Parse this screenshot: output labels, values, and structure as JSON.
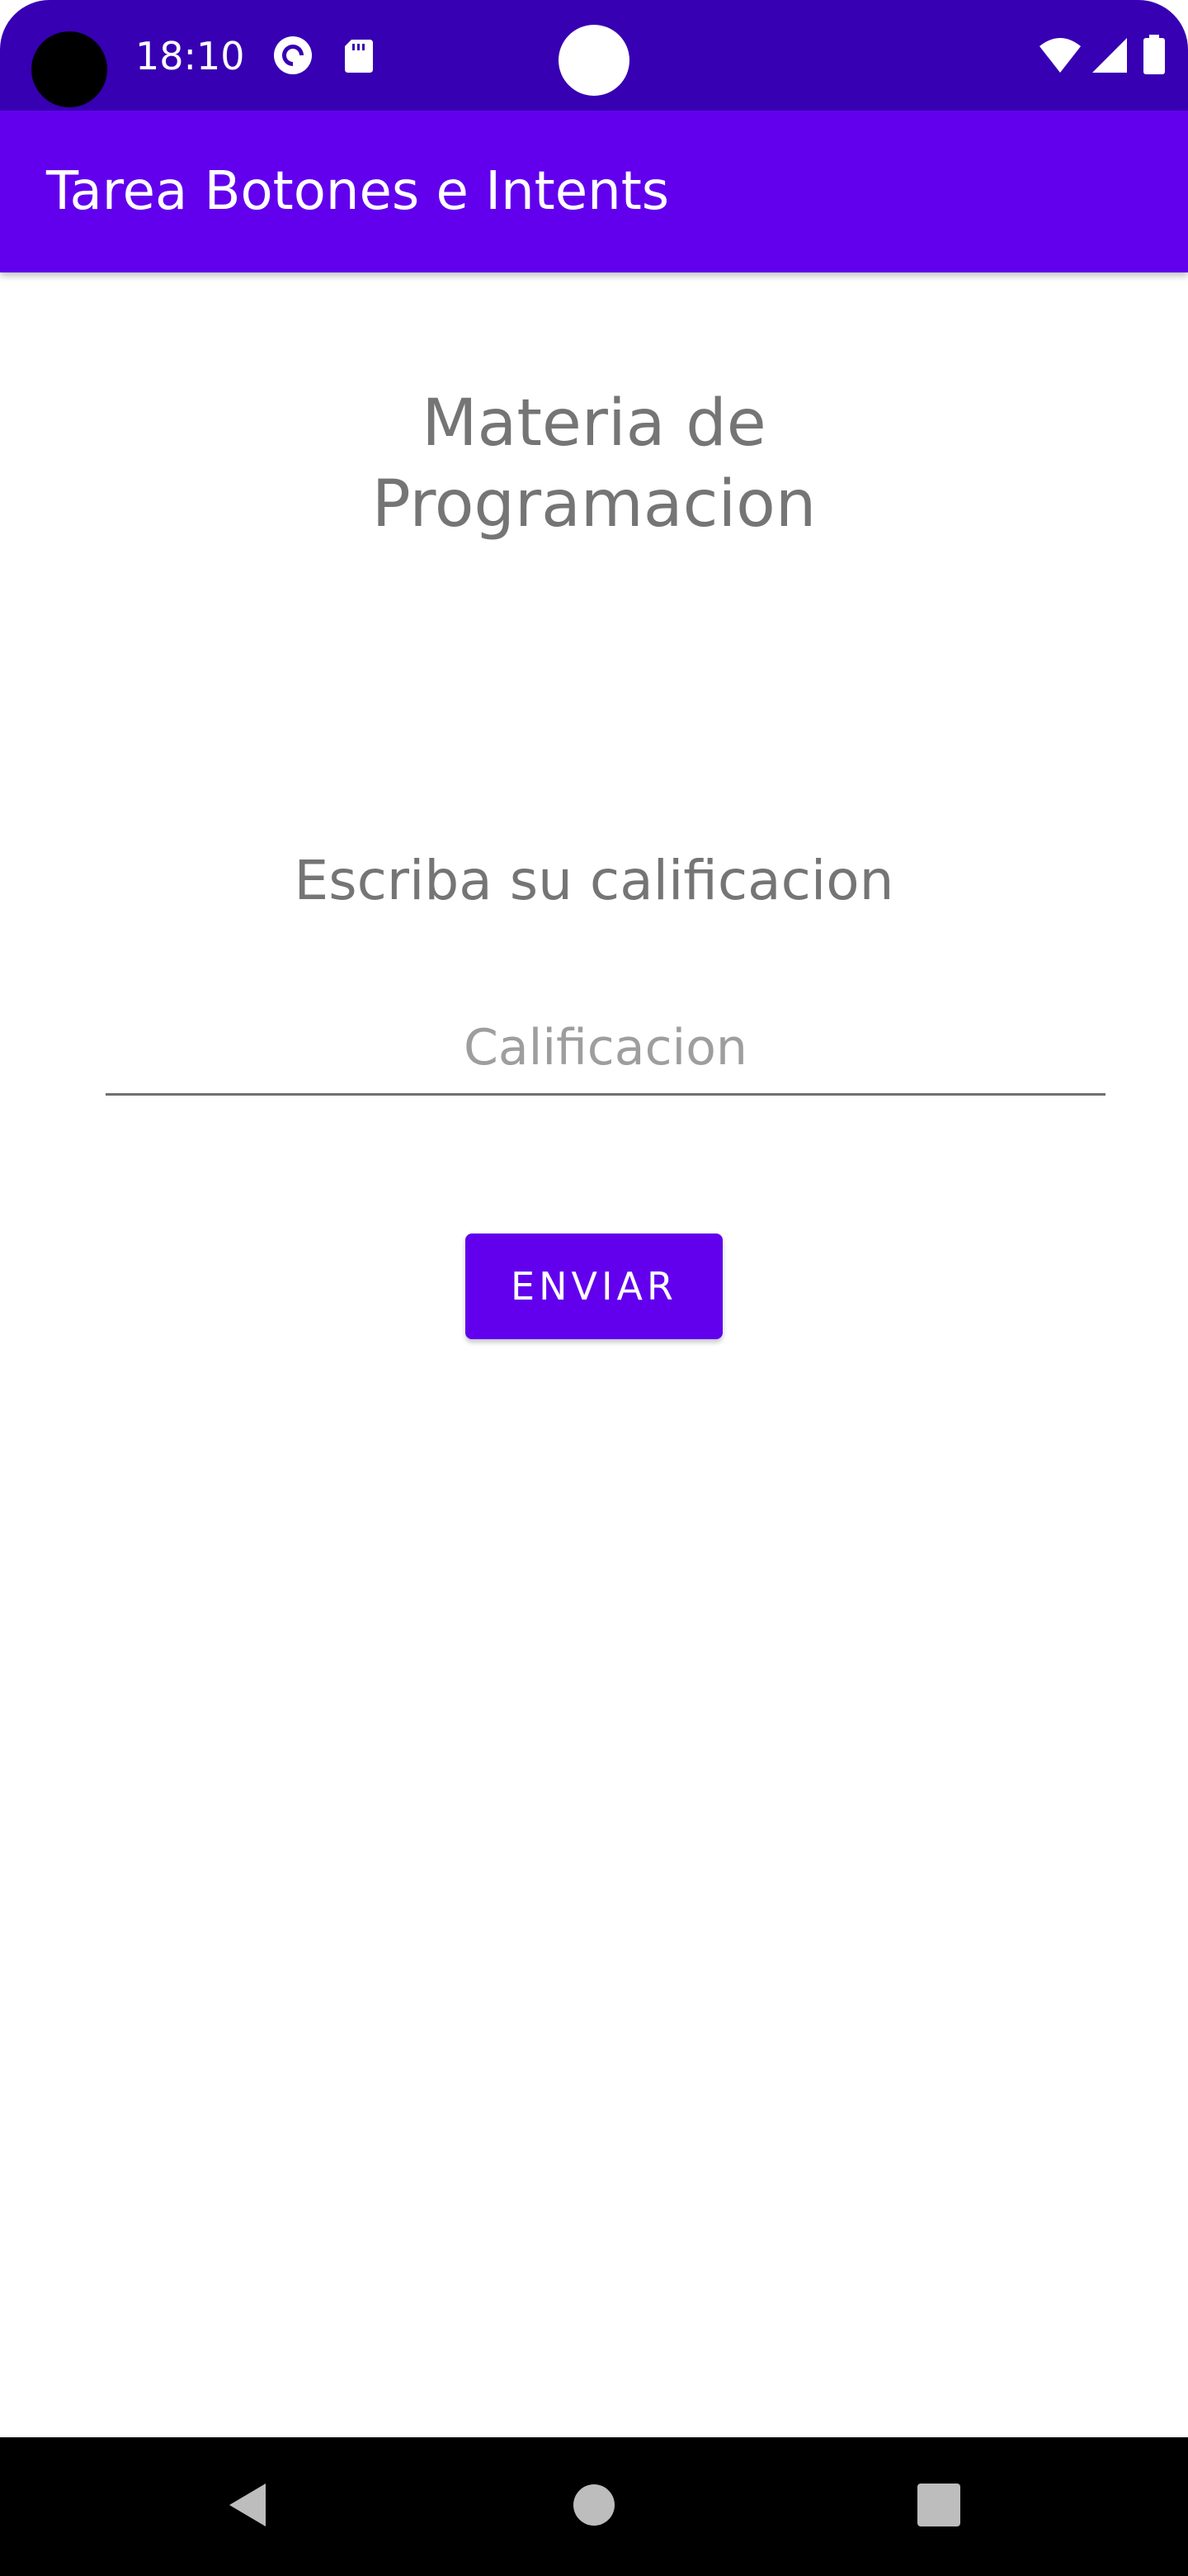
{
  "status_bar": {
    "time": "18:10",
    "background_color": "#3700B3",
    "left_icons": [
      "pocket-casts-icon",
      "sd-card-icon"
    ],
    "right_icons": [
      "wifi-icon",
      "cellular-signal-icon",
      "battery-icon"
    ]
  },
  "app_bar": {
    "title": "Tarea Botones e Intents",
    "background_color": "#6200EE"
  },
  "main": {
    "subject_line_1": "Materia de",
    "subject_line_2": "Programacion",
    "prompt": "Escriba su calificacion",
    "grade_input": {
      "value": "",
      "placeholder": "Calificacion"
    },
    "send_button_label": "ENVIAR"
  },
  "nav_bar": {
    "buttons": [
      "back-icon",
      "home-icon",
      "recents-icon"
    ]
  }
}
